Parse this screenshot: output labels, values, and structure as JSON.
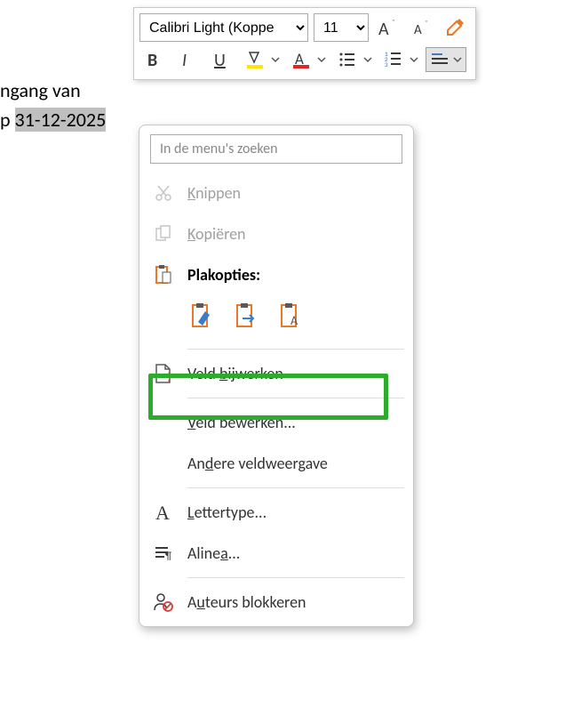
{
  "document": {
    "line1": "ngang van",
    "line2_prefix": "p ",
    "line2_highlighted_before": "31-12-2",
    "line2_highlighted_after": "025"
  },
  "toolbar": {
    "font_name": "Calibri Light (Koppe",
    "font_size": "11"
  },
  "context_menu": {
    "search_placeholder": "In de menu's zoeken",
    "cut_label": "Knippen",
    "cut_underline": "K",
    "copy_label": "opiëren",
    "copy_underline": "K",
    "paste_header": "Plakopties:",
    "update_field_pre": "Veld ",
    "update_field_underline": "b",
    "update_field_post": "ijwerken",
    "edit_field_pre": "",
    "edit_field_underline": "V",
    "edit_field_post": "eld bewerken...",
    "toggle_field_pre": "An",
    "toggle_field_underline": "d",
    "toggle_field_post": "ere veldweergave",
    "font_pre": "",
    "font_underline": "L",
    "font_post": "ettertype...",
    "paragraph_pre": "Aline",
    "paragraph_underline": "a",
    "paragraph_post": "...",
    "block_authors_pre": "A",
    "block_authors_underline": "u",
    "block_authors_post": "teurs blokkeren"
  }
}
